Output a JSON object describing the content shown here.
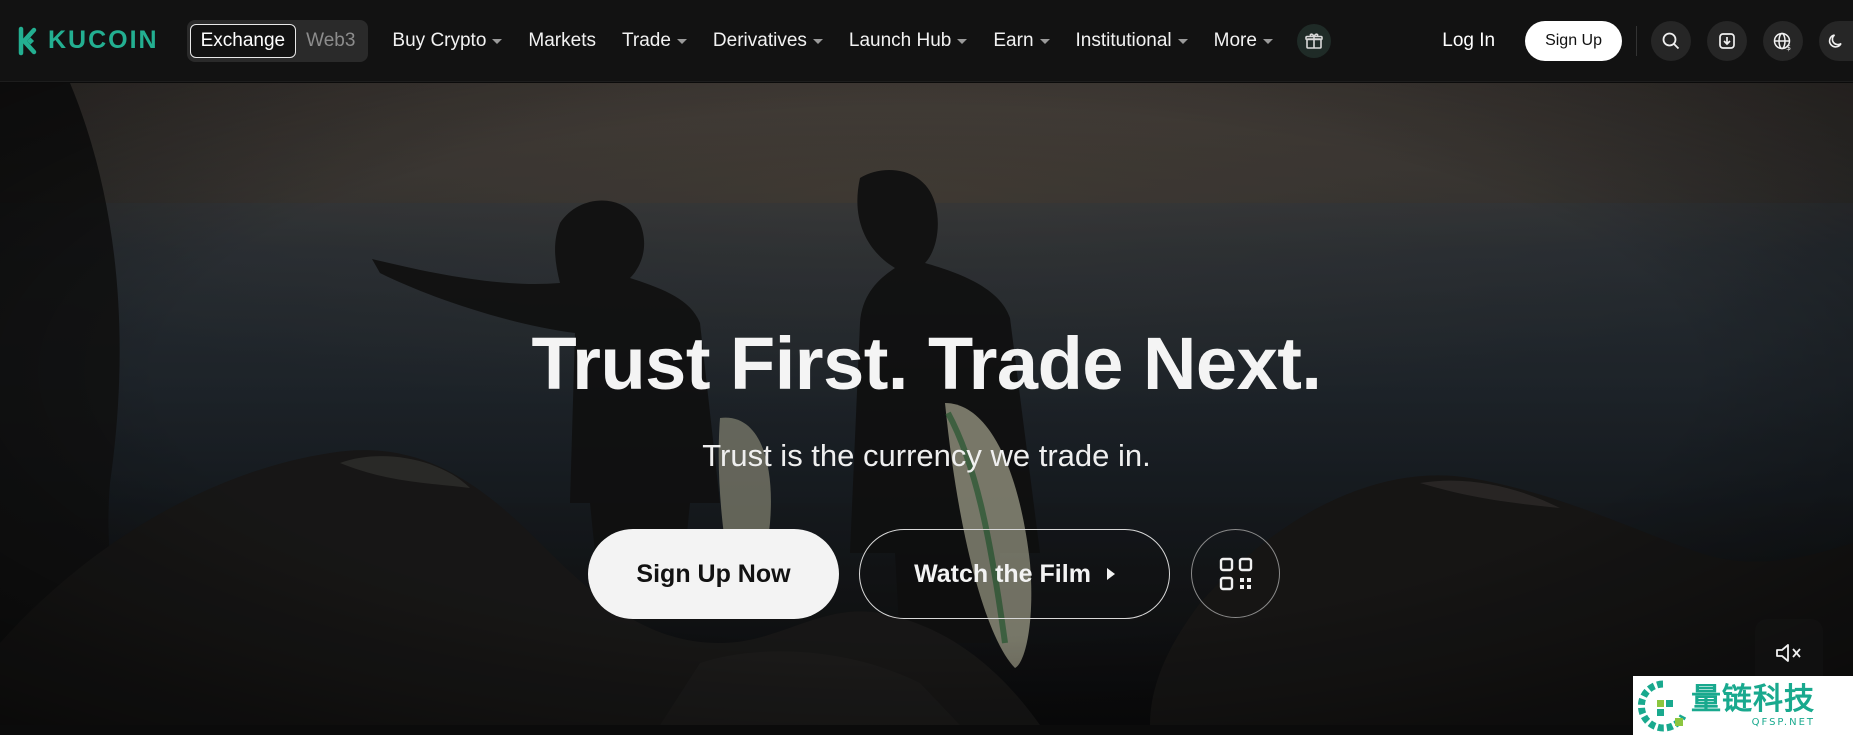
{
  "brand": {
    "name": "KUCOIN",
    "accent": "#23af91"
  },
  "mode_switch": {
    "items": [
      {
        "label": "Exchange",
        "active": true
      },
      {
        "label": "Web3",
        "active": false
      }
    ]
  },
  "menu": [
    {
      "label": "Buy Crypto",
      "dropdown": true
    },
    {
      "label": "Markets",
      "dropdown": false
    },
    {
      "label": "Trade",
      "dropdown": true
    },
    {
      "label": "Derivatives",
      "dropdown": true
    },
    {
      "label": "Launch Hub",
      "dropdown": true
    },
    {
      "label": "Earn",
      "dropdown": true
    },
    {
      "label": "Institutional",
      "dropdown": true
    },
    {
      "label": "More",
      "dropdown": true
    }
  ],
  "header_actions": {
    "login_label": "Log In",
    "signup_label": "Sign Up",
    "icons": [
      "gift-icon",
      "search-icon",
      "download-icon",
      "language-currency-icon",
      "theme-moon-icon"
    ]
  },
  "hero": {
    "title": "Trust First. Trade Next.",
    "subtitle": "Trust is the currency we trade in.",
    "primary_cta": "Sign Up Now",
    "secondary_cta": "Watch the Film",
    "qr_icon": "qr-code-icon",
    "mute_icon": "mute-icon"
  },
  "watermark": {
    "text_cn": "量链科技",
    "text_en": "QFSP.NET"
  }
}
